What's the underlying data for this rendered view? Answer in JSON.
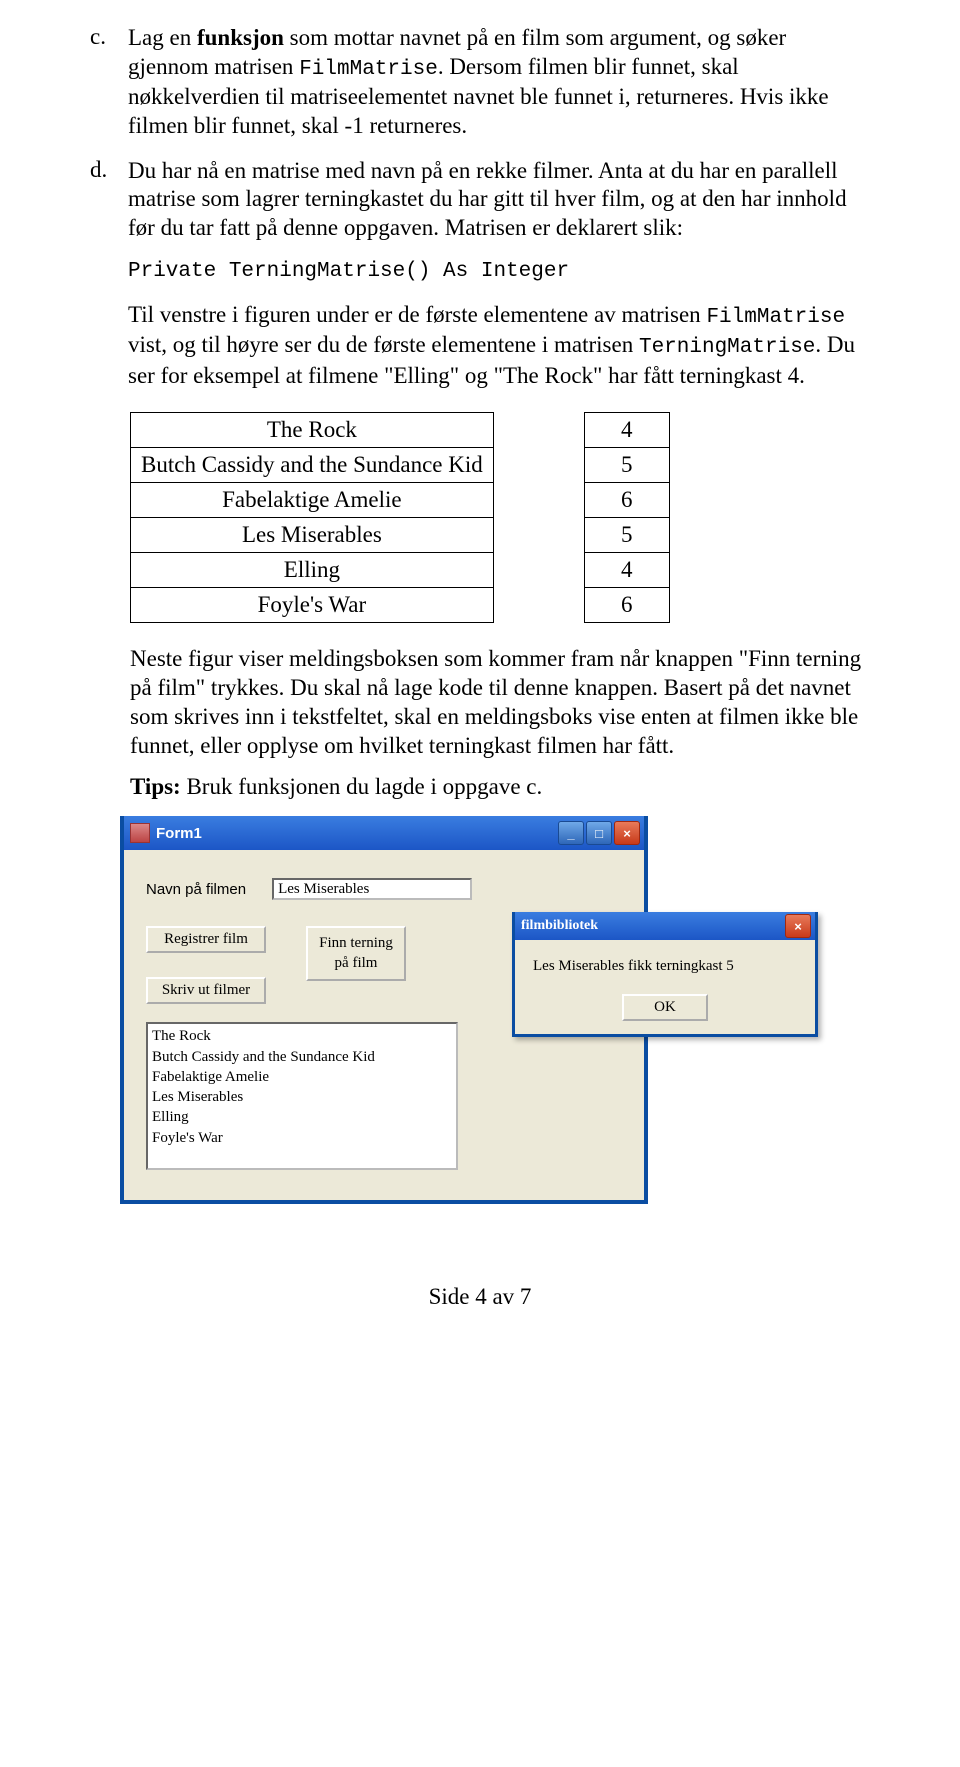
{
  "tasks": {
    "c": {
      "label": "c.",
      "text1a": "Lag en ",
      "text1b": "funksjon",
      "text1c": " som mottar navnet på en film som argument, og søker gjennom matrisen ",
      "code1": "FilmMatrise",
      "text1d": ". Dersom filmen blir funnet, skal nøkkelverdien til matriseelementet navnet ble funnet i, returneres. Hvis ikke filmen blir funnet, skal -1 returneres."
    },
    "d": {
      "label": "d.",
      "text1": "Du har nå en matrise med navn på en rekke filmer. Anta at du har en parallell matrise som lagrer terningkastet du har gitt til hver film, og at den har innhold før du tar fatt på denne oppgaven. Matrisen er deklarert slik:",
      "code_decl": "Private TerningMatrise() As Integer",
      "text2a": "Til venstre i figuren under er de første elementene av matrisen ",
      "code2": "FilmMatrise",
      "text2b": " vist, og til høyre ser du de første elementene i matrisen ",
      "code3": "TerningMatrise",
      "text2c": ". Du ser for eksempel at filmene \"Elling\" og \"The Rock\" har fått terningkast 4."
    }
  },
  "chart_data": {
    "type": "table",
    "title": "FilmMatrise / TerningMatrise",
    "films": [
      "The Rock",
      "Butch Cassidy and the Sundance Kid",
      "Fabelaktige Amelie",
      "Les Miserables",
      "Elling",
      "Foyle's War"
    ],
    "dice": [
      4,
      5,
      6,
      5,
      4,
      6
    ]
  },
  "after_tables": "Neste figur viser meldingsboksen som kommer fram når knappen \"Finn terning på film\" trykkes. Du skal nå lage kode til denne knappen. Basert på det navnet som skrives inn i tekstfeltet, skal en meldingsboks vise enten at filmen ikke ble funnet, eller opplyse om hvilket terningkast filmen har fått.",
  "tips_label": "Tips:",
  "tips_text": " Bruk funksjonen du lagde i oppgave c.",
  "form": {
    "title": "Form1",
    "label_navn": "Navn på filmen",
    "textbox_value": "Les Miserables",
    "btn_registrer": "Registrer film",
    "btn_skriv": "Skriv ut filmer",
    "btn_finn_line1": "Finn terning",
    "btn_finn_line2": "på film",
    "list_items": [
      "The Rock",
      "Butch Cassidy and the Sundance Kid",
      "Fabelaktige Amelie",
      "Les Miserables",
      "Elling",
      "Foyle's War"
    ]
  },
  "dialog": {
    "title": "filmbibliotek",
    "message": "Les Miserables fikk terningkast 5",
    "ok": "OK"
  },
  "footer": "Side 4 av 7"
}
